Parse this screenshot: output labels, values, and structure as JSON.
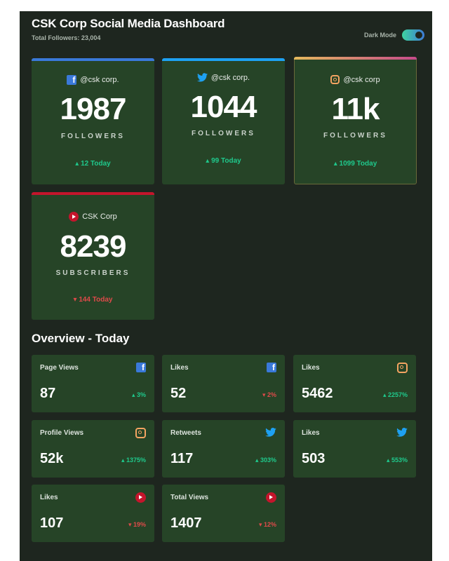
{
  "header": {
    "title": "CSK Corp Social Media Dashboard",
    "total_followers": "Total Followers: 23,004",
    "dark_mode_label": "Dark Mode",
    "dark_mode_on": true
  },
  "colors": {
    "background": "#1e261f",
    "card": "#264427",
    "facebook": "#3a79d9",
    "twitter": "#1ea1f2",
    "instagram": "#f4a462",
    "youtube": "#c4152c",
    "positive": "#1fc98c",
    "negative": "#de4a4a"
  },
  "cards": [
    {
      "network_icon": "facebook-icon",
      "handle": "@csk corp.",
      "count": "1987",
      "label": "FOLLOWERS",
      "today": "▴ 12 Today",
      "trend": "up"
    },
    {
      "network_icon": "twitter-icon",
      "handle": "@csk corp.",
      "count": "1044",
      "label": "FOLLOWERS",
      "today": "▴ 99 Today",
      "trend": "up"
    },
    {
      "network_icon": "instagram-icon",
      "handle": "@csk corp",
      "count": "11k",
      "label": "FOLLOWERS",
      "today": "▴ 1099 Today",
      "trend": "up"
    },
    {
      "network_icon": "youtube-icon",
      "handle": "CSK Corp",
      "count": "8239",
      "label": "SUBSCRIBERS",
      "today": "▾ 144 Today",
      "trend": "down"
    }
  ],
  "overview": {
    "title": "Overview - Today",
    "items": [
      {
        "label": "Page Views",
        "icon": "facebook-icon",
        "value": "87",
        "change": "▴ 3%",
        "trend": "up"
      },
      {
        "label": "Likes",
        "icon": "facebook-icon",
        "value": "52",
        "change": "▾ 2%",
        "trend": "down"
      },
      {
        "label": "Likes",
        "icon": "instagram-icon",
        "value": "5462",
        "change": "▴ 2257%",
        "trend": "up"
      },
      {
        "label": "Profile Views",
        "icon": "instagram-icon",
        "value": "52k",
        "change": "▴ 1375%",
        "trend": "up"
      },
      {
        "label": "Retweets",
        "icon": "twitter-icon",
        "value": "117",
        "change": "▴ 303%",
        "trend": "up"
      },
      {
        "label": "Likes",
        "icon": "twitter-icon",
        "value": "503",
        "change": "▴ 553%",
        "trend": "up"
      },
      {
        "label": "Likes",
        "icon": "youtube-icon",
        "value": "107",
        "change": "▾ 19%",
        "trend": "down"
      },
      {
        "label": "Total Views",
        "icon": "youtube-icon",
        "value": "1407",
        "change": "▾ 12%",
        "trend": "down"
      }
    ]
  }
}
